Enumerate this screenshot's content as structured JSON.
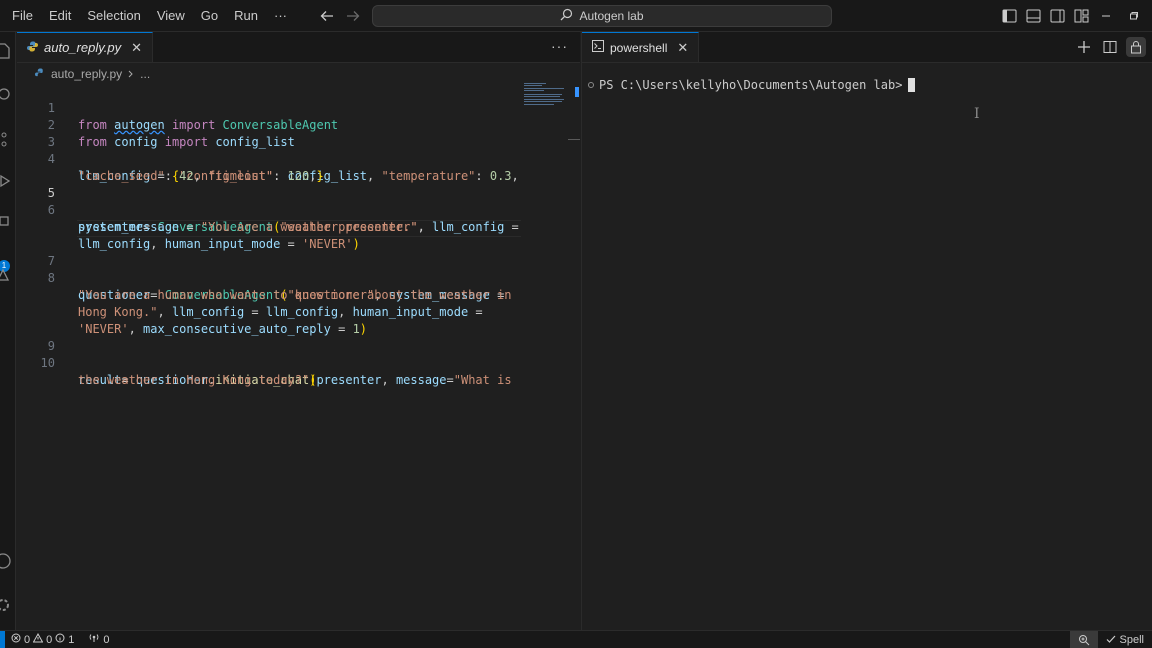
{
  "menu": [
    "File",
    "Edit",
    "Selection",
    "View",
    "Go",
    "Run",
    "···"
  ],
  "command_center": {
    "label": "Autogen lab",
    "icon": "search-icon"
  },
  "editor": {
    "tab_label": "auto_reply.py",
    "tab_close": "✕",
    "tabs_more": "···",
    "breadcrumb": {
      "file": "auto_reply.py",
      "more": "..."
    },
    "line_numbers": [
      "1",
      "2",
      "3",
      "4",
      "5",
      "6",
      "7",
      "8",
      "9",
      "10"
    ],
    "code": {
      "l1": {
        "t0": "from",
        "t1": "autogen",
        "t2": "import",
        "t3": "ConversableAgent"
      },
      "l2": {
        "t0": "from",
        "t1": "config",
        "t2": "import",
        "t3": "config_list"
      },
      "l4a": {
        "t0": "llm_config",
        "t1": " = ",
        "t2": "{",
        "t3": "\"config_list\"",
        "t4": ": ",
        "t5": "config_list",
        "t6": ", ",
        "t7": "\"temperature\"",
        "t8": ": ",
        "t9": "0.3",
        "t10": ","
      },
      "l4b": {
        "t0": "\"cache_seed\"",
        "t1": ": ",
        "t2": "42",
        "t3": ", ",
        "t4": "\"timeout\"",
        "t5": ": ",
        "t6": "120",
        "t7": ",",
        "t8": "}"
      },
      "l6a": {
        "t0": "presenter",
        "t1": "= ",
        "t2": "ConversableAgent",
        "t3": "(",
        "t4": "\"weather presenter\"",
        "t5": ","
      },
      "l6b": {
        "t0": "system_message",
        "t1": " = ",
        "t2": "\"You are a weather presenter.\"",
        "t3": ", ",
        "t4": "llm_config",
        "t5": " ="
      },
      "l6c": {
        "t0": "llm_config",
        "t1": ", ",
        "t2": "human_input_mode",
        "t3": " = ",
        "t4": "'NEVER'",
        "t5": ")"
      },
      "l8a": {
        "t0": "questioner",
        "t1": "= ",
        "t2": "ConversableAgent",
        "t3": "(",
        "t4": "\"questioner\"",
        "t5": ", ",
        "t6": "system_message",
        "t7": " ="
      },
      "l8b": {
        "t0": "\"You are a human who wants to know more about the weather in"
      },
      "l8c": {
        "t0": "Hong Kong.\"",
        "t1": ", ",
        "t2": "llm_config",
        "t3": " = ",
        "t4": "llm_config",
        "t5": ", ",
        "t6": "human_input_mode",
        "t7": " ="
      },
      "l8d": {
        "t0": "'NEVER'",
        "t1": ", ",
        "t2": "max_consecutive_auto_reply",
        "t3": " = ",
        "t4": "1",
        "t5": ")"
      },
      "l10a": {
        "t0": "result",
        "t1": "= ",
        "t2": "questioner",
        "t3": ".",
        "t4": "initiate_chat",
        "t5": "(",
        "t6": "presenter",
        "t7": ", ",
        "t8": "message",
        "t9": "=",
        "t10": "\"What is"
      },
      "l10b": {
        "t0": "the weather in Hong Kong today?\"",
        "t1": ")"
      }
    }
  },
  "terminal": {
    "tab_label": "powershell",
    "tab_close": "✕",
    "prompt": "PS C:\\Users\\kellyho\\Documents\\Autogen lab>"
  },
  "status": {
    "errors": "0",
    "warnings": "0",
    "info": "1",
    "ports": "0",
    "spell": "Spell"
  },
  "colors": {
    "accent": "#0078d4",
    "keyword": "#c586c0",
    "string": "#ce9178",
    "class": "#4ec9b0",
    "variable": "#9cdcfe",
    "number": "#b5cea8"
  }
}
